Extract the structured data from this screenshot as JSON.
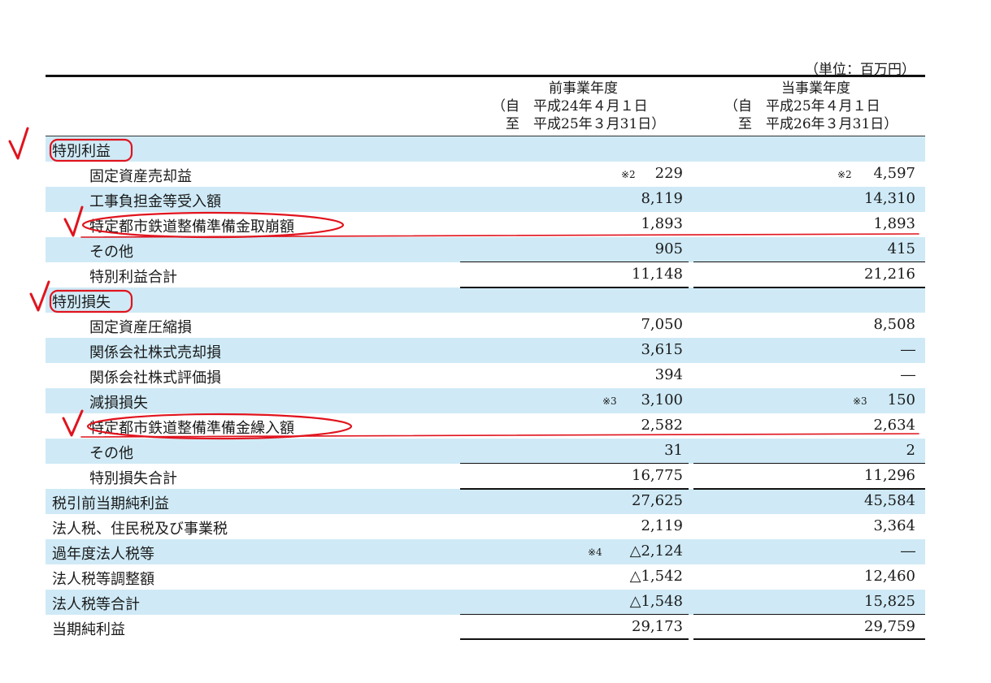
{
  "unit": "（単位：百万円）",
  "columns": {
    "prev": {
      "title": "前事業年度",
      "from": "（自　平成24年４月１日",
      "to": "至　平成25年３月31日）"
    },
    "curr": {
      "title": "当事業年度",
      "from": "（自　平成25年４月１日",
      "to": "至　平成26年３月31日）"
    }
  },
  "rows": [
    {
      "label": "特別利益",
      "prev": "",
      "curr": ""
    },
    {
      "label": "固定資産売却益",
      "prev_note": "※2",
      "prev": "229",
      "curr_note": "※2",
      "curr": "4,597"
    },
    {
      "label": "工事負担金等受入額",
      "prev": "8,119",
      "curr": "14,310"
    },
    {
      "label": "特定都市鉄道整備準備金取崩額",
      "prev": "1,893",
      "curr": "1,893"
    },
    {
      "label": "その他",
      "prev": "905",
      "curr": "415"
    },
    {
      "label": "特別利益合計",
      "prev": "11,148",
      "curr": "21,216"
    },
    {
      "label": "特別損失",
      "prev": "",
      "curr": ""
    },
    {
      "label": "固定資産圧縮損",
      "prev": "7,050",
      "curr": "8,508"
    },
    {
      "label": "関係会社株式売却損",
      "prev": "3,615",
      "curr": "―"
    },
    {
      "label": "関係会社株式評価損",
      "prev": "394",
      "curr": "―"
    },
    {
      "label": "減損損失",
      "prev_note": "※3",
      "prev": "3,100",
      "curr_note": "※3",
      "curr": "150"
    },
    {
      "label": "特定都市鉄道整備準備金繰入額",
      "prev": "2,582",
      "curr": "2,634"
    },
    {
      "label": "その他",
      "prev": "31",
      "curr": "2"
    },
    {
      "label": "特別損失合計",
      "prev": "16,775",
      "curr": "11,296"
    },
    {
      "label": "税引前当期純利益",
      "prev": "27,625",
      "curr": "45,584"
    },
    {
      "label": "法人税、住民税及び事業税",
      "prev": "2,119",
      "curr": "3,364"
    },
    {
      "label": "過年度法人税等",
      "prev_note": "※4",
      "prev": "△2,124",
      "curr": "―"
    },
    {
      "label": "法人税等調整額",
      "prev": "△1,542",
      "curr": "12,460"
    },
    {
      "label": "法人税等合計",
      "prev": "△1,548",
      "curr": "15,825"
    },
    {
      "label": "当期純利益",
      "prev": "29,173",
      "curr": "29,759"
    }
  ],
  "annotation_color": "#e0141e"
}
